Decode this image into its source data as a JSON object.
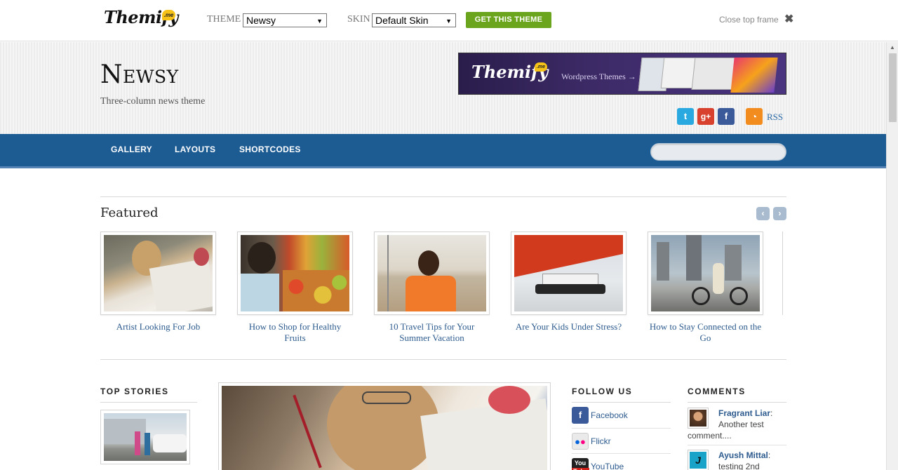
{
  "topframe": {
    "logo": "Themify",
    "logo_badge": ".me",
    "theme_label": "THEME",
    "theme_value": "Newsy",
    "skin_label": "SKIN",
    "skin_value": "Default Skin",
    "get_button": "GET THIS THEME",
    "close_label": "Close top frame",
    "close_icon": "✖"
  },
  "header": {
    "site_title": "Newsy",
    "site_description": "Three-column news theme",
    "banner_logo": "Themify",
    "banner_badge": ".me",
    "banner_text": "Wordpress Themes →",
    "social": [
      "twitter-icon",
      "google-plus-icon",
      "facebook-icon",
      "rss-icon"
    ],
    "rss_label": "RSS"
  },
  "nav": {
    "items": [
      "GALLERY",
      "LAYOUTS",
      "SHORTCODES"
    ],
    "search_placeholder": ""
  },
  "featured": {
    "title": "Featured",
    "prev_icon": "‹",
    "next_icon": "›",
    "items": [
      {
        "caption": "Artist Looking For Job"
      },
      {
        "caption": "How to Shop for Healthy Fruits"
      },
      {
        "caption": "10 Travel Tips for Your Summer Vacation"
      },
      {
        "caption": "Are Your Kids Under Stress?"
      },
      {
        "caption": "How to Stay Connected on the Go"
      }
    ]
  },
  "columns": {
    "top_stories": "TOP STORIES",
    "follow_us": "FOLLOW US",
    "comments": "COMMENTS",
    "follow_items": [
      "Facebook",
      "Flickr",
      "YouTube"
    ],
    "comment_items": [
      {
        "author": "Fragrant Liar",
        "text": "Another test comment...."
      },
      {
        "author": "Ayush Mittal",
        "text": "testing 2nd"
      }
    ]
  },
  "colors": {
    "nav_bg": "#1d5b93",
    "link": "#2d5b8e",
    "get_button": "#6ba51d"
  }
}
